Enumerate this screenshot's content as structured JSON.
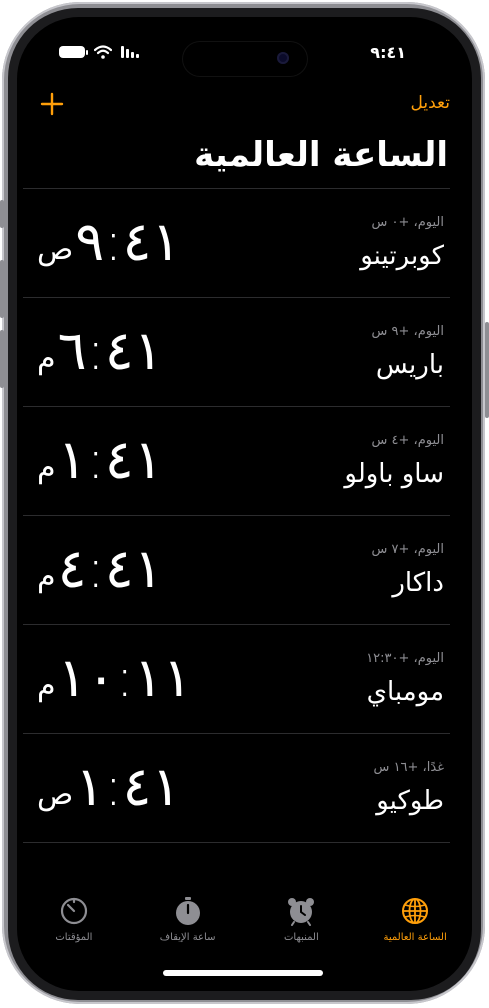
{
  "status_bar": {
    "time": "٩:٤١"
  },
  "header": {
    "edit_label": "تعديل",
    "title": "الساعة العالمية"
  },
  "clocks": [
    {
      "offset": "اليوم، +٠ س",
      "city": "كوبرتينو",
      "time": "٩:٤١",
      "ampm": "ص"
    },
    {
      "offset": "اليوم، +٩ س",
      "city": "باريس",
      "time": "٦:٤١",
      "ampm": "م"
    },
    {
      "offset": "اليوم، +٤ س",
      "city": "ساو باولو",
      "time": "١:٤١",
      "ampm": "م"
    },
    {
      "offset": "اليوم، +٧ س",
      "city": "داكار",
      "time": "٤:٤١",
      "ampm": "م"
    },
    {
      "offset": "اليوم، +١٢:٣٠",
      "city": "مومباي",
      "time": "١٠:١١",
      "ampm": "م"
    },
    {
      "offset": "غدًا، +١٦ س",
      "city": "طوكيو",
      "time": "١:٤١",
      "ampm": "ص"
    }
  ],
  "tabs": [
    {
      "label": "المؤقتات",
      "icon": "timer-icon"
    },
    {
      "label": "ساعة الإيقاف",
      "icon": "stopwatch-icon"
    },
    {
      "label": "المنبهات",
      "icon": "alarm-icon"
    },
    {
      "label": "الساعة العالمية",
      "icon": "globe-icon",
      "active": true
    }
  ],
  "colors": {
    "accent": "#ff9f0a",
    "background": "#000000",
    "secondary_text": "#8e8e93",
    "separator": "#2c2c2e"
  }
}
